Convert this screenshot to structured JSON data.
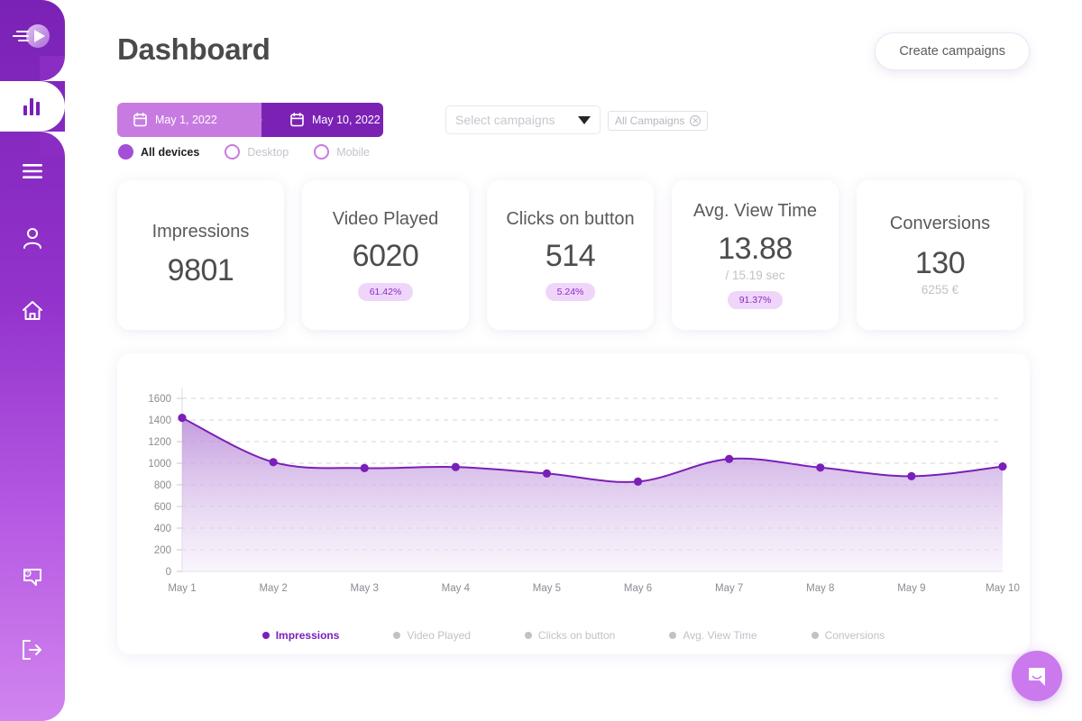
{
  "header": {
    "title": "Dashboard",
    "create_button": "Create campaigns"
  },
  "sidebar": {
    "logo_icon": "play-logo-icon",
    "items": [
      {
        "icon": "bar-chart-icon",
        "name": "analytics",
        "active": true
      },
      {
        "icon": "hamburger-menu-icon",
        "name": "menu",
        "active": false
      },
      {
        "icon": "user-icon",
        "name": "profile",
        "active": false
      },
      {
        "icon": "home-icon",
        "name": "home",
        "active": false
      },
      {
        "icon": "help-chat-icon",
        "name": "help",
        "active": false
      },
      {
        "icon": "logout-icon",
        "name": "logout",
        "active": false
      }
    ]
  },
  "filters": {
    "date_range": {
      "start_label": "May 1, 2022",
      "end_label": "May 10, 2022",
      "start_color": "#C77BE0",
      "end_color": "#7B22B5",
      "icon": "calendar-icon"
    },
    "devices": {
      "options": [
        {
          "label": "All devices",
          "selected": true
        },
        {
          "label": "Desktop",
          "selected": false
        },
        {
          "label": "Mobile",
          "selected": false
        }
      ]
    },
    "campaign_select": {
      "placeholder": "Select campaigns",
      "value": "",
      "chevron_icon": "chevron-down-icon"
    },
    "campaign_tag": {
      "label": "All Campaigns",
      "remove_icon": "close-circle-icon"
    }
  },
  "kpi_cards": [
    {
      "title": "Impressions",
      "value": "9801",
      "sub": "",
      "badge": ""
    },
    {
      "title": "Video Played",
      "value": "6020",
      "sub": "",
      "badge": "61.42%"
    },
    {
      "title": "Clicks on button",
      "value": "514",
      "sub": "",
      "badge": "5.24%"
    },
    {
      "title": "Avg. View Time",
      "value": "13.88",
      "sub": "/ 15.19 sec",
      "badge": "91.37%"
    },
    {
      "title": "Conversions",
      "value": "130",
      "sub": "6255 €",
      "badge": ""
    }
  ],
  "chart_data": {
    "type": "area",
    "title": "",
    "xlabel": "",
    "ylabel": "",
    "grid": true,
    "legend_position": "bottom",
    "x": [
      "May 1",
      "May 2",
      "May 3",
      "May 4",
      "May 5",
      "May 6",
      "May 7",
      "May 8",
      "May 9",
      "May 10"
    ],
    "yticks": [
      0,
      200,
      400,
      600,
      800,
      1000,
      1200,
      1400,
      1600
    ],
    "ylim": [
      0,
      1600
    ],
    "series": [
      {
        "name": "Impressions",
        "active": true,
        "color": "#7A1FB8",
        "values": [
          1420,
          1010,
          955,
          965,
          905,
          830,
          1040,
          960,
          880,
          970
        ]
      },
      {
        "name": "Video Played",
        "active": false,
        "color": "#c3c0c8",
        "values": []
      },
      {
        "name": "Clicks on button",
        "active": false,
        "color": "#c3c0c8",
        "values": []
      },
      {
        "name": "Avg. View Time",
        "active": false,
        "color": "#c3c0c8",
        "values": []
      },
      {
        "name": "Conversions",
        "active": false,
        "color": "#c3c0c8",
        "values": []
      }
    ]
  },
  "chat": {
    "icon": "chat-bubble-icon",
    "color": "#CA7AEC"
  },
  "theme": {
    "primary": "#7A22B5",
    "accent": "#A34FD8",
    "badge_bg": "#F0D5FA",
    "badge_text": "#8B2BC4"
  }
}
